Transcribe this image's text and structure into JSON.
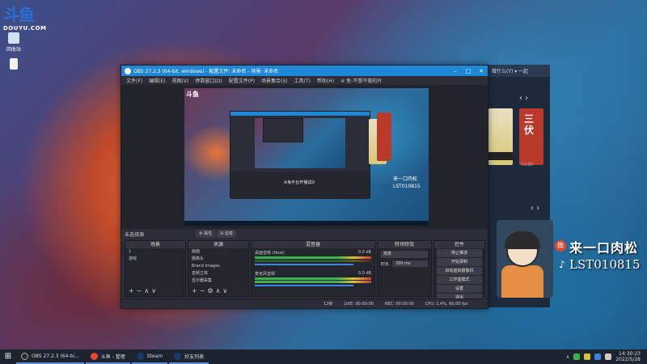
{
  "desktop": {
    "logo_mark": "斗鱼",
    "logo_sub": "DOUYU.COM",
    "icons": [
      {
        "label": "回收站",
        "icon": "recycle-bin-icon"
      },
      {
        "label": "",
        "icon": "file-icon"
      }
    ]
  },
  "obs": {
    "title": "OBS 27.2.3 (64-bit, windows) - 配置文件: 未命名 - 场景: 未命名",
    "menu": [
      "文件(F)",
      "编辑(E)",
      "视图(V)",
      "停靠窗口(D)",
      "配置文件(P)",
      "场景集合(S)",
      "工具(T)",
      "帮助(H)",
      "※ 免-不想不做的片"
    ],
    "preview_subtitle": "※免平台开播试D",
    "scene_label": "未选择源",
    "props_button": "属性",
    "filters_button": "滤镜",
    "docks": {
      "scenes": {
        "title": "场景",
        "items": [
          "1",
          "游戏"
        ]
      },
      "sources": {
        "title": "来源",
        "items": [
          "画面",
          "摄像头",
          "Brand Images",
          "音频立体",
          "显示器采集"
        ]
      },
      "mixer": {
        "title": "混音器",
        "channels": [
          {
            "name": "桌面音频 (Host)",
            "db": "0.0 dB"
          },
          {
            "name": "麦克风音频",
            "db": "0.0 dB"
          }
        ]
      },
      "transitions": {
        "title": "转场特效",
        "type": "渐变",
        "duration_label": "时长",
        "duration_value": "300 ms"
      },
      "controls": {
        "title": "控件",
        "buttons": [
          "停止推流",
          "开始录制",
          "启动虚拟摄像机",
          "工作室模式",
          "设置",
          "退出"
        ]
      }
    },
    "status": {
      "dropped": "12帧",
      "live": "LIVE: 00:00:00",
      "rec": "REC: 00:00:00",
      "cpu": "CPU: 1.4%, 60.00 fps"
    }
  },
  "side_app": {
    "bar": "做什么(Y) ▾ 一起",
    "card_label": "ical",
    "card_label2": "《三伏》",
    "card_title": "三伏"
  },
  "overlay": {
    "name": "来一口肉松",
    "id": "LST010815",
    "weibo": "微",
    "tiktok": "♪"
  },
  "taskbar": {
    "start": "⊞",
    "items": [
      {
        "label": "OBS 27.2.3 (64-bi...",
        "color": "#2b2e38"
      },
      {
        "label": "斗鱼 - 管理",
        "color": "#e84530"
      },
      {
        "label": "Steam",
        "color": "#1a3a6a"
      },
      {
        "label": "好友列表",
        "color": "#1a3a6a"
      }
    ],
    "time": "14:30:23",
    "date": "2022/5/28"
  }
}
